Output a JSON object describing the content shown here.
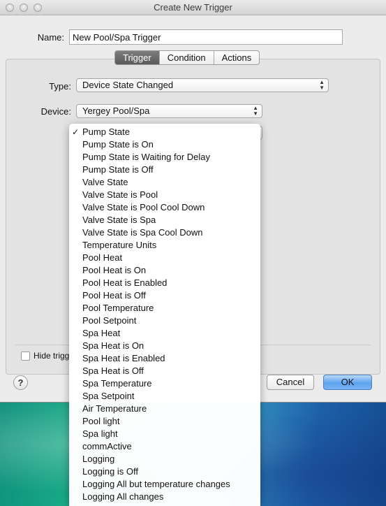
{
  "window": {
    "title": "Create New Trigger"
  },
  "name": {
    "label": "Name:",
    "value": "New Pool/Spa Trigger"
  },
  "tabs": [
    {
      "label": "Trigger",
      "active": true
    },
    {
      "label": "Condition",
      "active": false
    },
    {
      "label": "Actions",
      "active": false
    }
  ],
  "type": {
    "label": "Type:",
    "value": "Device State Changed"
  },
  "device": {
    "label": "Device:",
    "value": "Yergey Pool/Spa"
  },
  "state_menu": {
    "selected_index": 0,
    "check_mark": "✓",
    "items": [
      "Pump State",
      "Pump State is On",
      "Pump State is Waiting for Delay",
      "Pump State is Off",
      "Valve State",
      "Valve State is Pool",
      "Valve State is Pool Cool Down",
      "Valve State is Spa",
      "Valve State is Spa Cool Down",
      "Temperature Units",
      "Pool Heat",
      "Pool Heat is On",
      "Pool Heat is Enabled",
      "Pool Heat is Off",
      "Pool Temperature",
      "Pool Setpoint",
      "Spa Heat",
      "Spa Heat is On",
      "Spa Heat is Enabled",
      "Spa Heat is Off",
      "Spa Temperature",
      "Spa Setpoint",
      "Air Temperature",
      "Pool light",
      "Spa light",
      "commActive",
      "Logging",
      "Logging is Off",
      "Logging All but temperature changes",
      "Logging All changes"
    ]
  },
  "footer": {
    "hide_label": "Hide trigg",
    "help_label": "?",
    "cancel_label": "Cancel",
    "ok_label": "OK"
  },
  "colors": {
    "ok_accent": "#5ea3ee"
  }
}
